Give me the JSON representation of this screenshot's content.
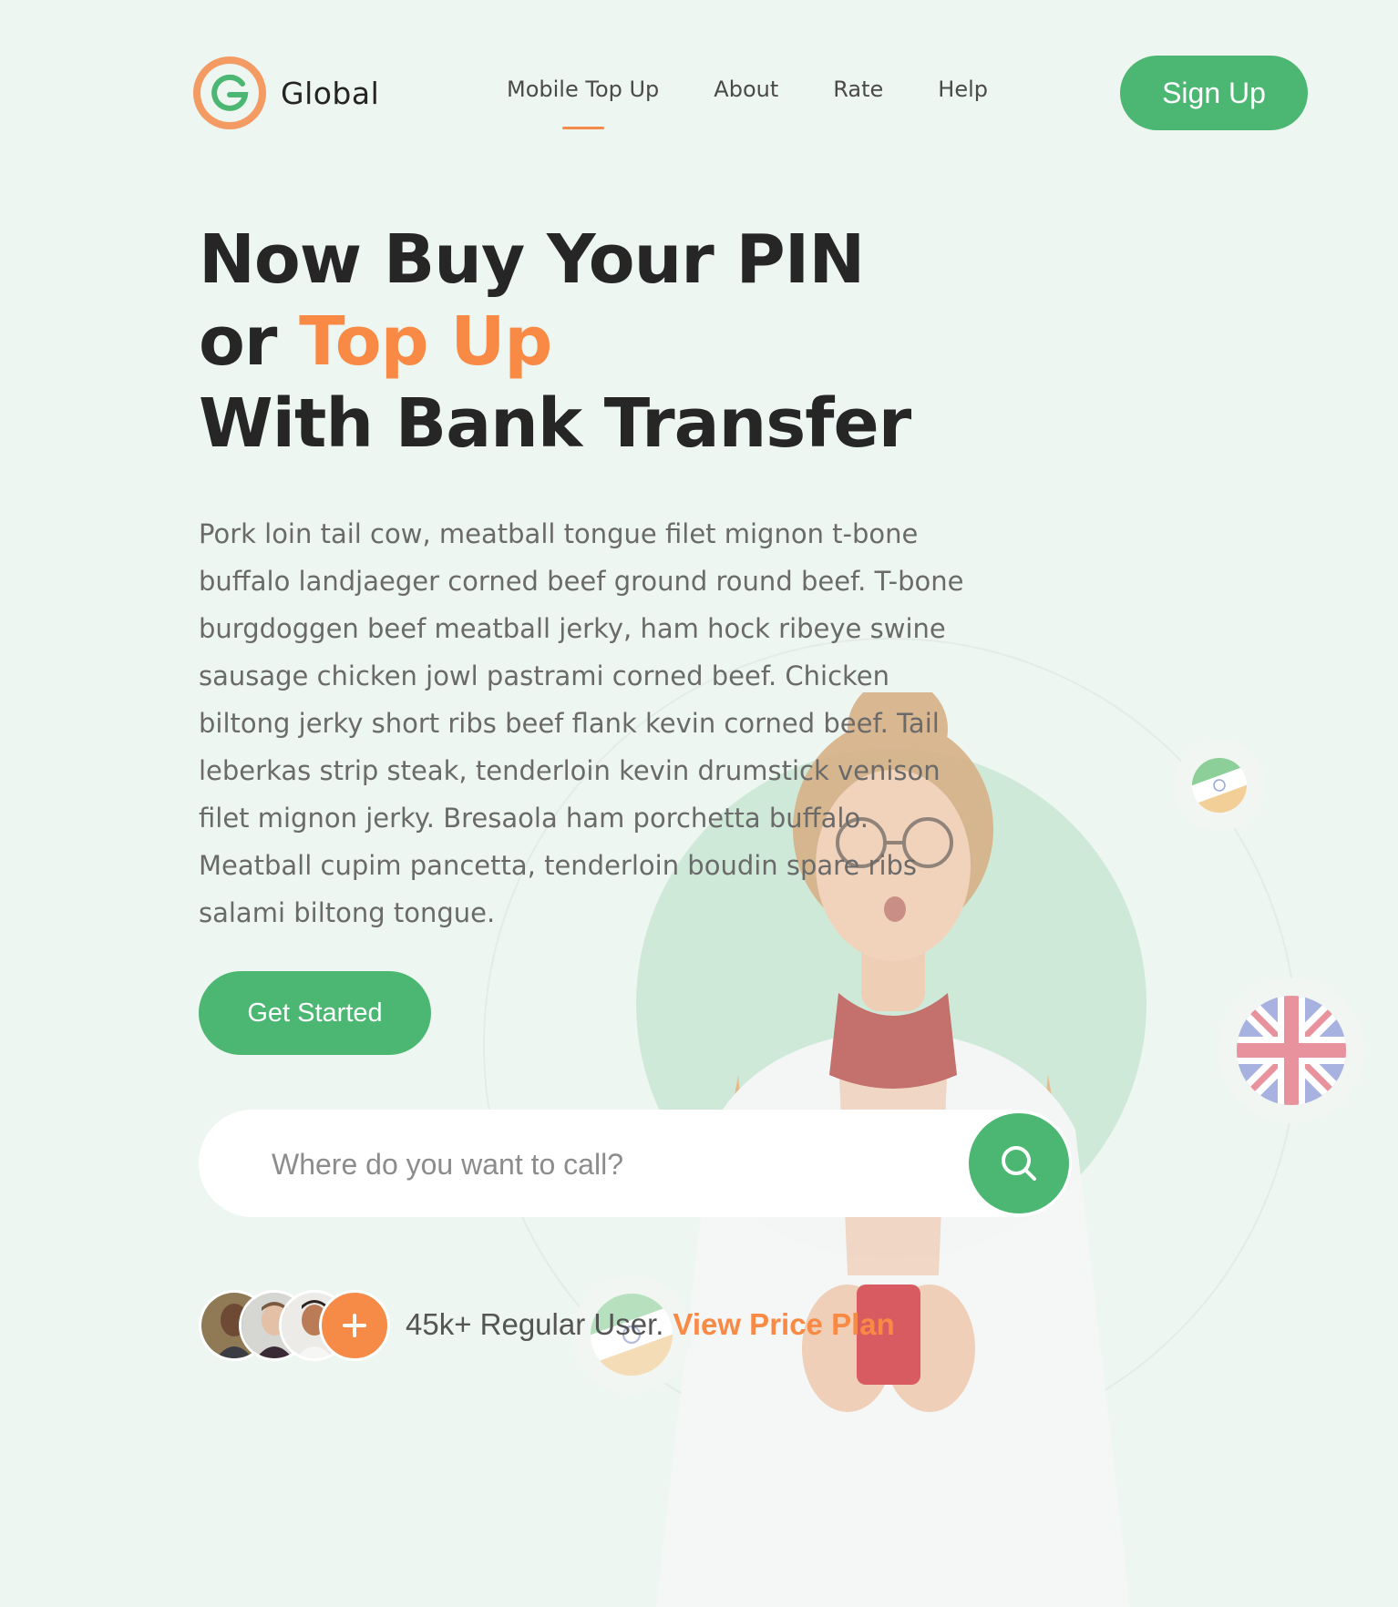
{
  "brand": {
    "name": "Global",
    "logo_letter": "G"
  },
  "nav": {
    "items": [
      {
        "label": "Mobile Top Up",
        "active": true
      },
      {
        "label": "About",
        "active": false
      },
      {
        "label": "Rate",
        "active": false
      },
      {
        "label": "Help",
        "active": false
      }
    ]
  },
  "header": {
    "signup_label": "Sign Up"
  },
  "hero": {
    "headline_line1": "Now Buy Your PIN",
    "headline_line2_prefix": "or ",
    "headline_line2_accent": "Top Up",
    "headline_line3": "With Bank Transfer",
    "description_lines": [
      "Pork loin tail cow, meatball tongue filet mignon t-bone",
      "buffalo landjaeger corned beef ground round beef. T-bone",
      "burgdoggen beef meatball jerky, ham hock ribeye swine",
      "sausage chicken jowl pastrami corned beef. Chicken",
      "biltong jerky short ribs beef flank kevin corned beef. Tail",
      "leberkas strip steak, tenderloin kevin drumstick venison",
      "filet mignon jerky. Bresaola ham porchetta buffalo.",
      "Meatball cupim pancetta, tenderloin boudin spare ribs",
      "salami biltong tongue."
    ],
    "cta_label": "Get Started"
  },
  "search": {
    "placeholder": "Where do you want to call?",
    "value": ""
  },
  "social_proof": {
    "users_text": "45k+ Regular User.",
    "link_label": "View Price Plan",
    "more_symbol": "+"
  },
  "colors": {
    "background": "#eef6f1",
    "brand_green": "#4cb773",
    "accent_orange": "#f88a45",
    "heading": "#262626",
    "body_text": "#6a6a6a"
  },
  "icons": {
    "search": "search-icon",
    "logo": "g-logo-icon",
    "more": "plus-icon"
  }
}
